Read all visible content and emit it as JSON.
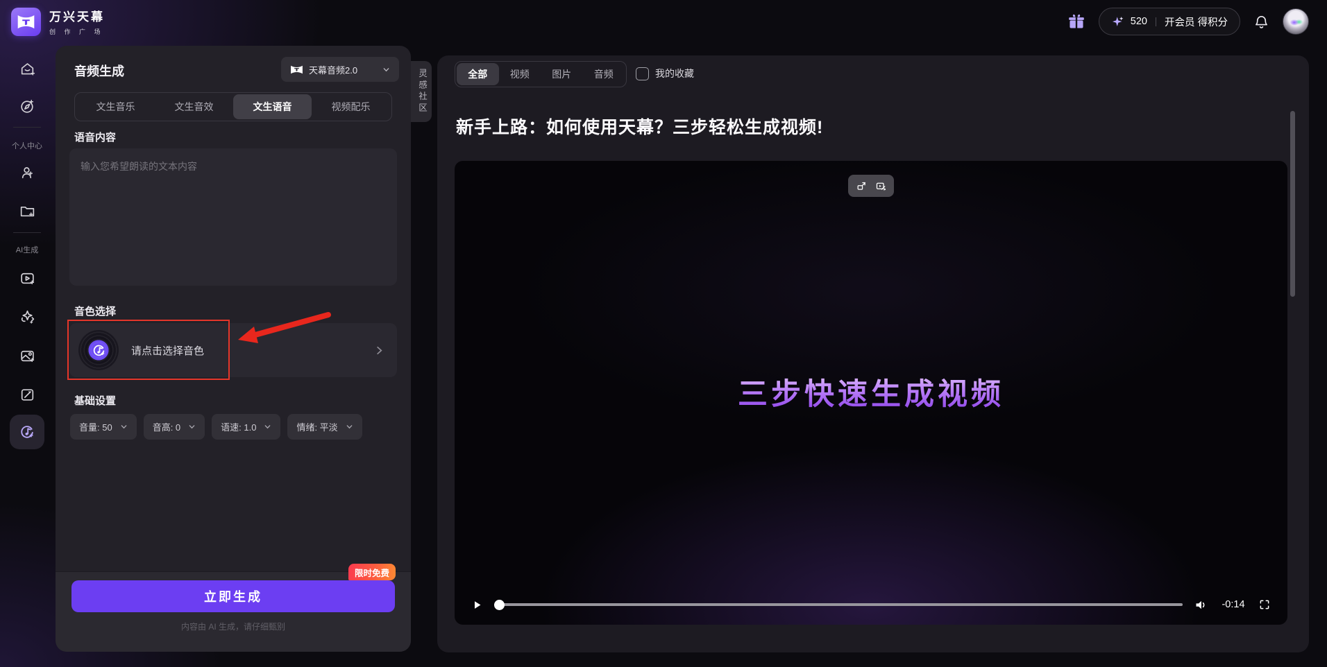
{
  "topbar": {
    "logo_title": "万兴天幕",
    "logo_subtitle": "创 作 广 场",
    "credits": "520",
    "membership_label": "开会员 得积分"
  },
  "sidebar": {
    "group1_label": "个人中心",
    "group2_label": "AI生成",
    "icons": [
      "home",
      "explore",
      "profile",
      "files",
      "video-generate",
      "effects",
      "image-generate",
      "ai-edit",
      "audio-generate"
    ]
  },
  "audio_panel": {
    "title": "音频生成",
    "model_selector": "天幕音频2.0",
    "tabs": [
      {
        "label": "文生音乐",
        "active": false
      },
      {
        "label": "文生音效",
        "active": false
      },
      {
        "label": "文生语音",
        "active": true
      },
      {
        "label": "视频配乐",
        "active": false
      }
    ],
    "voice_content_label": "语音内容",
    "voice_content_placeholder": "输入您希望朗读的文本内容",
    "voice_select_label": "音色选择",
    "voice_select_text": "请点击选择音色",
    "basic_settings_label": "基础设置",
    "settings": [
      {
        "name": "音量",
        "value": "50",
        "display": "音量: 50"
      },
      {
        "name": "音高",
        "value": "0",
        "display": "音高: 0"
      },
      {
        "name": "语速",
        "value": "1.0",
        "display": "语速: 1.0"
      },
      {
        "name": "情绪",
        "value": "平淡",
        "display": "情绪: 平淡"
      }
    ],
    "free_badge": "限时免费",
    "generate_button": "立即生成",
    "disclaimer": "内容由 AI 生成，请仔细甄别"
  },
  "community_tab_label": "灵感社区",
  "content": {
    "filter_tabs": [
      {
        "label": "全部",
        "active": true
      },
      {
        "label": "视频",
        "active": false
      },
      {
        "label": "图片",
        "active": false
      },
      {
        "label": "音频",
        "active": false
      }
    ],
    "favorites_label": "我的收藏",
    "page_title": "新手上路：如何使用天幕？三步轻松生成视频!",
    "video_player": {
      "caption": "三步快速生成视频",
      "time_remaining": "-0:14"
    }
  },
  "colors": {
    "accent_purple": "#6c3ef2",
    "highlight_red": "#e5362a",
    "badge_gradient": [
      "#fb3a4f",
      "#fd8a33"
    ],
    "caption_gradient": [
      "#e9ccff",
      "#8a3fe8"
    ]
  }
}
